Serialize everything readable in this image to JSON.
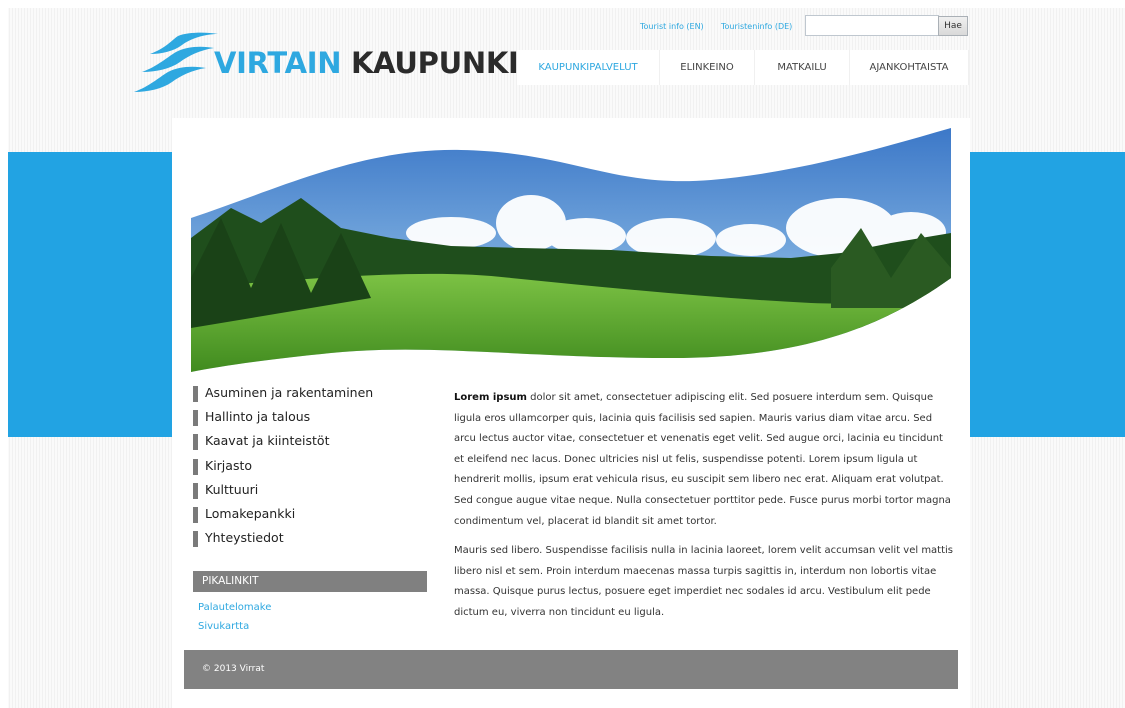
{
  "header": {
    "logo": {
      "word1": "VIRTAIN",
      "word2": "KAUPUNKI"
    },
    "toplinks": [
      "Tourist info (EN)",
      "Touristeninfo (DE)"
    ],
    "search": {
      "placeholder": "",
      "value": "",
      "button_label": "Hae"
    },
    "nav": [
      {
        "label": "KAUPUNKIPALVELUT",
        "active": true
      },
      {
        "label": "ELINKEINO",
        "active": false
      },
      {
        "label": "MATKAILU",
        "active": false
      },
      {
        "label": "AJANKOHTAISTA",
        "active": false
      }
    ]
  },
  "sidebar": {
    "items": [
      "Asuminen ja rakentaminen",
      "Hallinto ja talous",
      "Kaavat ja kiinteistöt",
      "Kirjasto",
      "Kulttuuri",
      "Lomakepankki",
      "Yhteystiedot"
    ],
    "quick_links": {
      "title": "PIKALINKIT",
      "links": [
        "Palautelomake",
        "Sivukartta"
      ]
    }
  },
  "content": {
    "p1_bold": "Lorem ipsum",
    "p1_rest": " dolor sit amet, consectetuer adipiscing elit. Sed posuere interdum sem. Quisque ligula eros ullamcorper quis, lacinia quis facilisis sed sapien. Mauris varius diam vitae arcu. Sed arcu lectus auctor vitae, consectetuer et venenatis eget velit. Sed augue orci, lacinia eu tincidunt et eleifend nec lacus. Donec ultricies nisl ut felis, suspendisse potenti. Lorem ipsum ligula ut hendrerit mollis, ipsum erat vehicula risus, eu suscipit sem libero nec erat. Aliquam erat volutpat. Sed congue augue vitae neque. Nulla consectetuer porttitor pede. Fusce purus morbi tortor magna condimentum vel, placerat id blandit sit amet tortor.",
    "p2": "Mauris sed libero. Suspendisse facilisis nulla in lacinia laoreet, lorem velit accumsan velit vel mattis libero nisl et sem. Proin interdum maecenas massa turpis sagittis in, interdum non lobortis vitae massa. Quisque purus lectus, posuere eget imperdiet nec sodales id arcu. Vestibulum elit pede dictum eu, viverra non tincidunt eu ligula."
  },
  "footer": {
    "copyright": "© 2013 Virrat"
  },
  "colors": {
    "accent": "#2ea8e0",
    "band": "#22a3e3",
    "gray": "#808080"
  }
}
